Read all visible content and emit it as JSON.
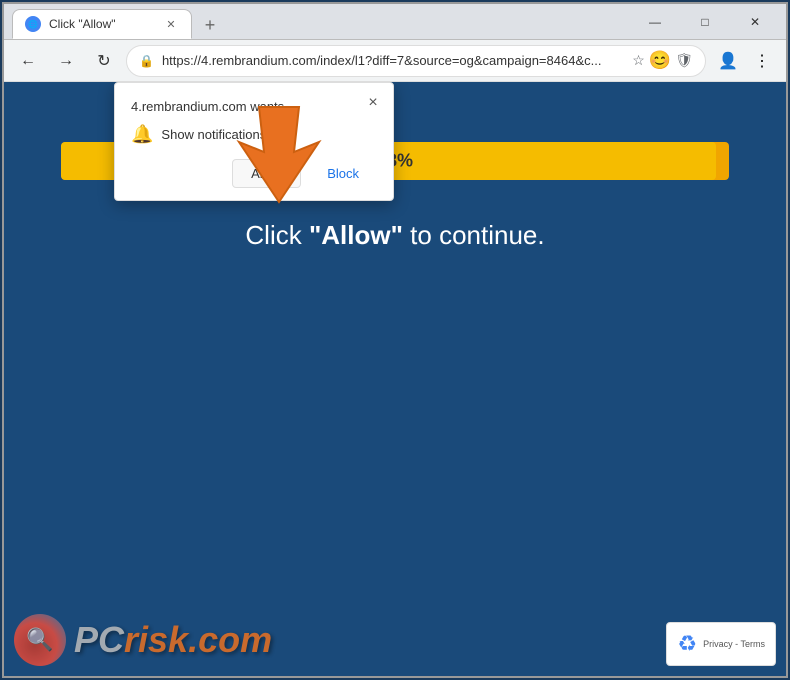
{
  "browser": {
    "tab": {
      "title": "Click \"Allow\"",
      "favicon": "🔵"
    },
    "new_tab_label": "+",
    "window_controls": {
      "minimize": "—",
      "maximize": "□",
      "close": "✕"
    },
    "nav": {
      "back": "←",
      "forward": "→",
      "refresh": "↻",
      "url": "https://4.rembrandium.com/index/l1?diff=7&source=og&campaign=8464&c...",
      "star": "☆",
      "shield": "🛡",
      "profile": "👤",
      "menu": "⋮"
    }
  },
  "popup": {
    "header": "4.rembrandium.com wants",
    "close_label": "×",
    "notification_text": "Show notifications",
    "allow_label": "Allow",
    "block_label": "Block"
  },
  "page": {
    "progress_percent": "98%",
    "cta_prefix": "Click ",
    "cta_bold": "\"Allow\"",
    "cta_suffix": " to continue."
  },
  "watermark": {
    "logo_icon": "🔍",
    "text_pc": "PC",
    "text_risk": "risk",
    "text_com": ".com"
  },
  "recaptcha": {
    "icon": "♻",
    "line1": "Privacy - Terms"
  },
  "colors": {
    "page_bg": "#1a4a7a",
    "progress_bg": "#f0a500",
    "progress_fill": "#f5c200",
    "allow_text": "#333",
    "block_text": "#1a73e8"
  }
}
